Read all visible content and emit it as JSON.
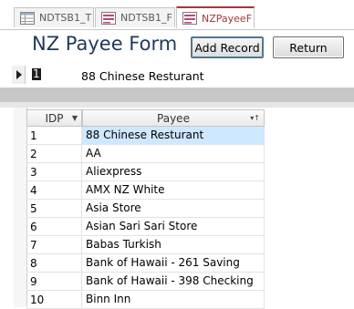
{
  "tabs": [
    {
      "label": "NDTSB1_T",
      "icon": "table-icon",
      "active": false
    },
    {
      "label": "NDTSB1_F",
      "icon": "form-icon",
      "active": false
    },
    {
      "label": "NZPayeeF",
      "icon": "form-icon",
      "active": true
    }
  ],
  "form": {
    "title": "NZ Payee Form",
    "add_record_label": "Add Record",
    "return_label": "Return"
  },
  "current_record": {
    "id": "1",
    "payee": "88 Chinese Resturant"
  },
  "datasheet": {
    "columns": [
      "IDP",
      "Payee"
    ],
    "rows": [
      {
        "idp": "1",
        "payee": "88 Chinese Resturant"
      },
      {
        "idp": "2",
        "payee": "AA"
      },
      {
        "idp": "3",
        "payee": "Aliexpress"
      },
      {
        "idp": "4",
        "payee": "AMX NZ White"
      },
      {
        "idp": "5",
        "payee": "Asia Store"
      },
      {
        "idp": "6",
        "payee": "Asian Sari Sari Store"
      },
      {
        "idp": "7",
        "payee": "Babas Turkish"
      },
      {
        "idp": "8",
        "payee": "Bank of Hawaii - 261 Saving"
      },
      {
        "idp": "9",
        "payee": "Bank of Hawaii - 398 Checking"
      },
      {
        "idp": "10",
        "payee": "Binn Inn"
      }
    ]
  },
  "colors": {
    "active_tab": "#a4373a",
    "selection": "#cde8ff",
    "title": "#1f3a5a"
  }
}
